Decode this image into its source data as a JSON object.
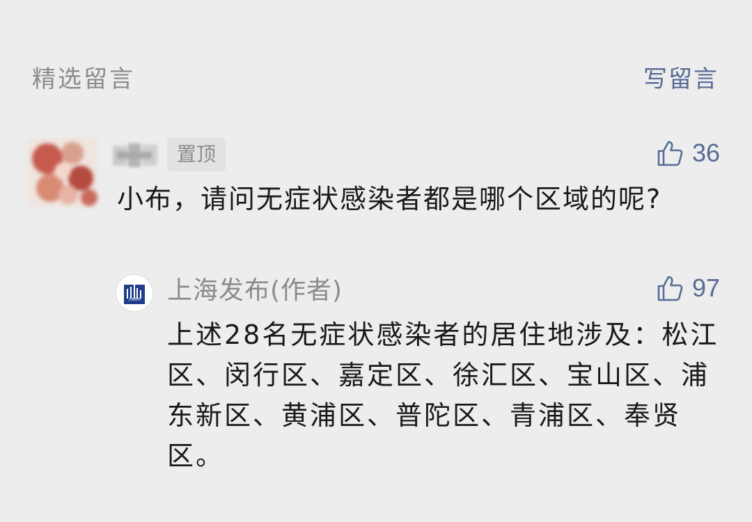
{
  "header": {
    "title": "精选留言",
    "write_label": "写留言"
  },
  "comments": [
    {
      "pinned_label": "置顶",
      "likes": "36",
      "text": "小布，请问无症状感染者都是哪个区域的呢?",
      "reply": {
        "author": "上海发布(作者)",
        "avatar_text": "上海发布",
        "likes": "97",
        "text": "上述28名无症状感染者的居住地涉及：松江区、闵行区、嘉定区、徐汇区、宝山区、浦东新区、黄浦区、普陀区、青浦区、奉贤区。"
      }
    }
  ],
  "colors": {
    "background": "#ededed",
    "link": "#576b95",
    "muted": "#8b8b8b",
    "text": "#191919"
  },
  "icons": {
    "like": "thumbs-up-icon"
  }
}
